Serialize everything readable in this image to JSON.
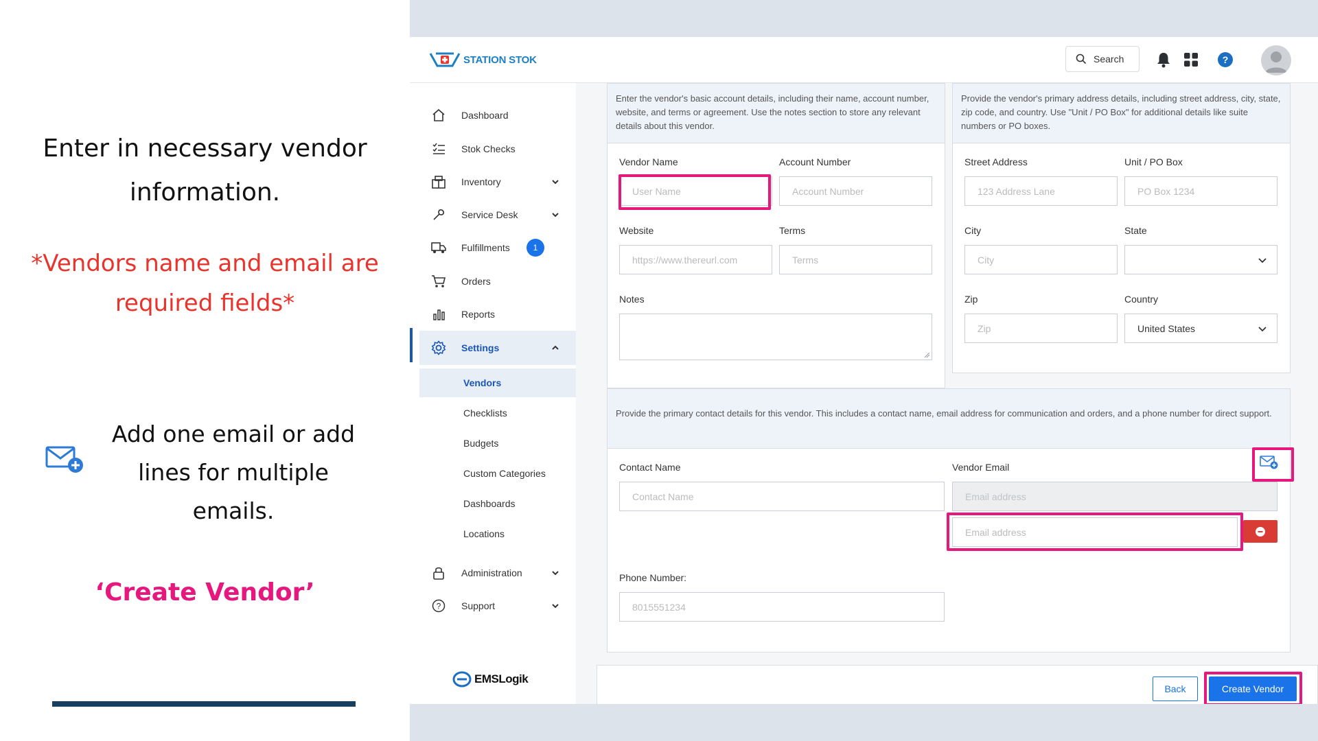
{
  "instructions": {
    "line1": "Enter in necessary vendor",
    "line2": "information.",
    "required_line1": "*Vendors name and email are",
    "required_line2": "required fields*",
    "email_line1": "Add one email or add",
    "email_line2": "lines for multiple emails.",
    "create_label": "‘Create Vendor’"
  },
  "header": {
    "logo_text": "STATION STOK",
    "search_label": "Search"
  },
  "sidebar": {
    "items": [
      {
        "label": "Dashboard"
      },
      {
        "label": "Stok Checks"
      },
      {
        "label": "Inventory"
      },
      {
        "label": "Service Desk"
      },
      {
        "label": "Fulfillments",
        "badge": "1"
      },
      {
        "label": "Orders"
      },
      {
        "label": "Reports"
      },
      {
        "label": "Settings"
      },
      {
        "label": "Administration"
      },
      {
        "label": "Support"
      }
    ],
    "settings_sub": [
      "Vendors",
      "Checklists",
      "Budgets",
      "Custom Categories",
      "Dashboards",
      "Locations"
    ],
    "footer_logo": "EMSLogik"
  },
  "account_card": {
    "description": "Enter the vendor's basic account details, including their name, account number, website, and terms or agreement. Use the notes section to store any relevant details about this vendor.",
    "vendor_name_label": "Vendor Name",
    "vendor_name_placeholder": "User Name",
    "account_number_label": "Account Number",
    "account_number_placeholder": "Account Number",
    "website_label": "Website",
    "website_placeholder": "https://www.thereurl.com",
    "terms_label": "Terms",
    "terms_placeholder": "Terms",
    "notes_label": "Notes"
  },
  "address_card": {
    "description": "Provide the vendor's primary address details, including street address, city, state, zip code, and country. Use \"Unit / PO Box\" for additional details like suite numbers or PO boxes.",
    "street_label": "Street Address",
    "street_placeholder": "123 Address Lane",
    "unit_label": "Unit / PO Box",
    "unit_placeholder": "PO Box 1234",
    "city_label": "City",
    "city_placeholder": "City",
    "state_label": "State",
    "zip_label": "Zip",
    "zip_placeholder": "Zip",
    "country_label": "Country",
    "country_value": "United States"
  },
  "contact_card": {
    "description": "Provide the primary contact details for this vendor. This includes a contact name, email address for communication and orders, and a phone number for direct support.",
    "contact_name_label": "Contact Name",
    "contact_name_placeholder": "Contact Name",
    "vendor_email_label": "Vendor Email",
    "email_placeholder_1": "Email address",
    "email_placeholder_2": "Email address",
    "phone_label": "Phone Number:",
    "phone_placeholder": "8015551234"
  },
  "actions": {
    "back_label": "Back",
    "create_label": "Create Vendor"
  },
  "colors": {
    "highlight": "#e6177d",
    "primary": "#1a73e8",
    "danger": "#d93b35",
    "required_text": "#e8342c"
  }
}
